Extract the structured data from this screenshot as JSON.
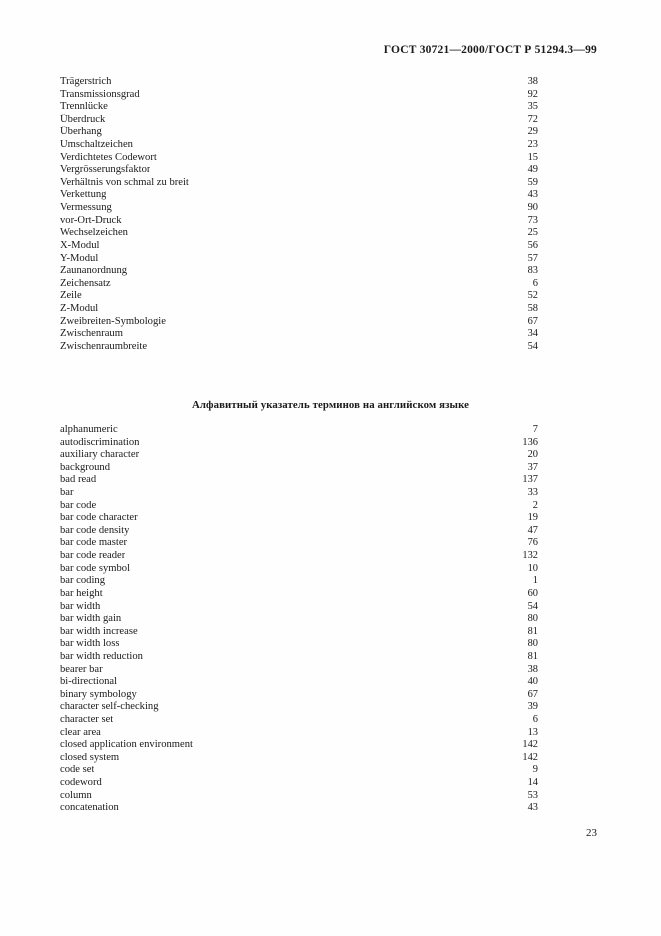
{
  "header": {
    "standard_reference": "ГОСТ 30721—2000/ГОСТ Р 51294.3—99"
  },
  "german_index": {
    "entries": [
      {
        "term": "Trägerstrich",
        "page": "38"
      },
      {
        "term": "Transmissionsgrad",
        "page": "92"
      },
      {
        "term": "Trennlücke",
        "page": "35"
      },
      {
        "term": "Überdruck",
        "page": "72"
      },
      {
        "term": "Überhang",
        "page": "29"
      },
      {
        "term": "Umschaltzeichen",
        "page": "23"
      },
      {
        "term": "Verdichtetes Codewort",
        "page": "15"
      },
      {
        "term": "Vergrösserungsfaktor",
        "page": "49"
      },
      {
        "term": "Verhältnis von schmal zu breit",
        "page": "59"
      },
      {
        "term": "Verkettung",
        "page": "43"
      },
      {
        "term": "Vermessung",
        "page": "90"
      },
      {
        "term": "vor-Ort-Druck",
        "page": "73"
      },
      {
        "term": "Wechselzeichen",
        "page": "25"
      },
      {
        "term": "X-Modul",
        "page": "56"
      },
      {
        "term": "Y-Modul",
        "page": "57"
      },
      {
        "term": "Zaunanordnung",
        "page": "83"
      },
      {
        "term": "Zeichensatz",
        "page": "6"
      },
      {
        "term": "Zeile",
        "page": "52"
      },
      {
        "term": "Z-Modul",
        "page": "58"
      },
      {
        "term": "Zweibreiten-Symbologie",
        "page": "67"
      },
      {
        "term": "Zwischenraum",
        "page": "34"
      },
      {
        "term": "Zwischenraumbreite",
        "page": "54"
      }
    ]
  },
  "english_section": {
    "heading": "Алфавитный указатель терминов на английском языке",
    "entries": [
      {
        "term": "alphanumeric",
        "page": "7"
      },
      {
        "term": "autodiscrimination",
        "page": "136"
      },
      {
        "term": "auxiliary character",
        "page": "20"
      },
      {
        "term": "background",
        "page": "37"
      },
      {
        "term": "bad read",
        "page": "137"
      },
      {
        "term": "bar",
        "page": "33"
      },
      {
        "term": "bar code",
        "page": "2"
      },
      {
        "term": "bar code character",
        "page": "19"
      },
      {
        "term": "bar code density",
        "page": "47"
      },
      {
        "term": "bar code master",
        "page": "76"
      },
      {
        "term": "bar code reader",
        "page": "132"
      },
      {
        "term": "bar code symbol",
        "page": "10"
      },
      {
        "term": "bar coding",
        "page": "1"
      },
      {
        "term": "bar height",
        "page": "60"
      },
      {
        "term": "bar width",
        "page": "54"
      },
      {
        "term": "bar width gain",
        "page": "80"
      },
      {
        "term": "bar width increase",
        "page": "81"
      },
      {
        "term": "bar width loss",
        "page": "80"
      },
      {
        "term": "bar width reduction",
        "page": "81"
      },
      {
        "term": "bearer bar",
        "page": "38"
      },
      {
        "term": "bi-directional",
        "page": "40"
      },
      {
        "term": "binary symbology",
        "page": "67"
      },
      {
        "term": "character self-checking",
        "page": "39"
      },
      {
        "term": "character set",
        "page": "6"
      },
      {
        "term": "clear area",
        "page": "13"
      },
      {
        "term": "closed application environment",
        "page": "142"
      },
      {
        "term": "closed system",
        "page": "142"
      },
      {
        "term": "code set",
        "page": "9"
      },
      {
        "term": "codeword",
        "page": "14"
      },
      {
        "term": "column",
        "page": "53"
      },
      {
        "term": "concatenation",
        "page": "43"
      }
    ]
  },
  "footer": {
    "page_number": "23"
  }
}
